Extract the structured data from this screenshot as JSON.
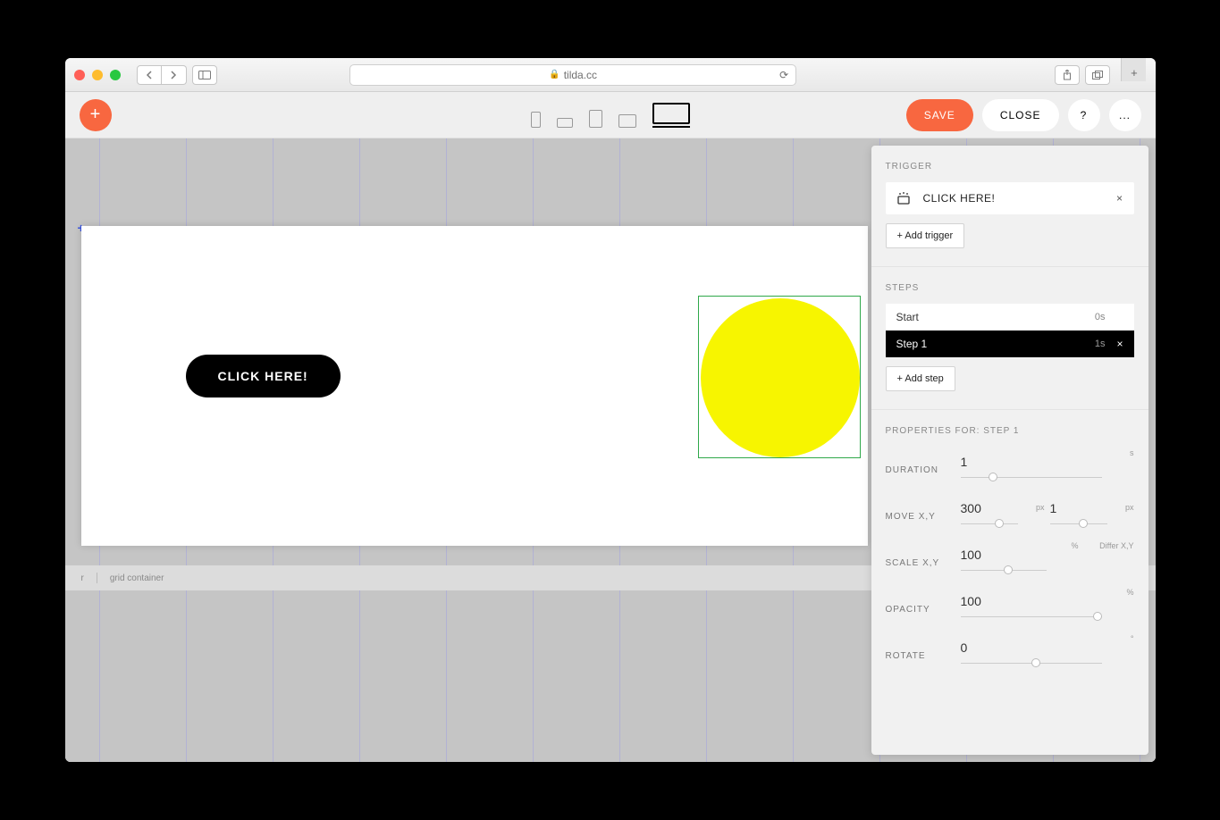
{
  "browser": {
    "url_display": "tilda.cc"
  },
  "toolbar": {
    "save": "SAVE",
    "close": "CLOSE",
    "help": "?",
    "more": "..."
  },
  "canvas": {
    "button_text": "CLICK HERE!",
    "footer_left": "r",
    "footer_item": "grid container"
  },
  "panel": {
    "trigger": {
      "heading": "TRIGGER",
      "item_label": "CLICK HERE!",
      "add_label": "+ Add trigger"
    },
    "steps": {
      "heading": "STEPS",
      "start_label": "Start",
      "start_time": "0s",
      "step1_label": "Step 1",
      "step1_time": "1s",
      "add_label": "+ Add step"
    },
    "props": {
      "heading": "PROPERTIES FOR: STEP 1",
      "duration": {
        "label": "DURATION",
        "value": "1",
        "unit": "s",
        "thumb_pct": 20
      },
      "move": {
        "label": "MOVE X,Y",
        "x": "300",
        "x_unit": "px",
        "x_thumb_pct": 60,
        "y": "1",
        "y_unit": "px",
        "y_thumb_pct": 50
      },
      "scale": {
        "label": "SCALE X,Y",
        "value": "100",
        "unit": "%",
        "thumb_pct": 50,
        "differ": "Differ X,Y"
      },
      "opacity": {
        "label": "OPACITY",
        "value": "100",
        "unit": "%",
        "thumb_pct": 100
      },
      "rotate": {
        "label": "ROTATE",
        "value": "0",
        "unit": "°",
        "thumb_pct": 50
      }
    }
  }
}
